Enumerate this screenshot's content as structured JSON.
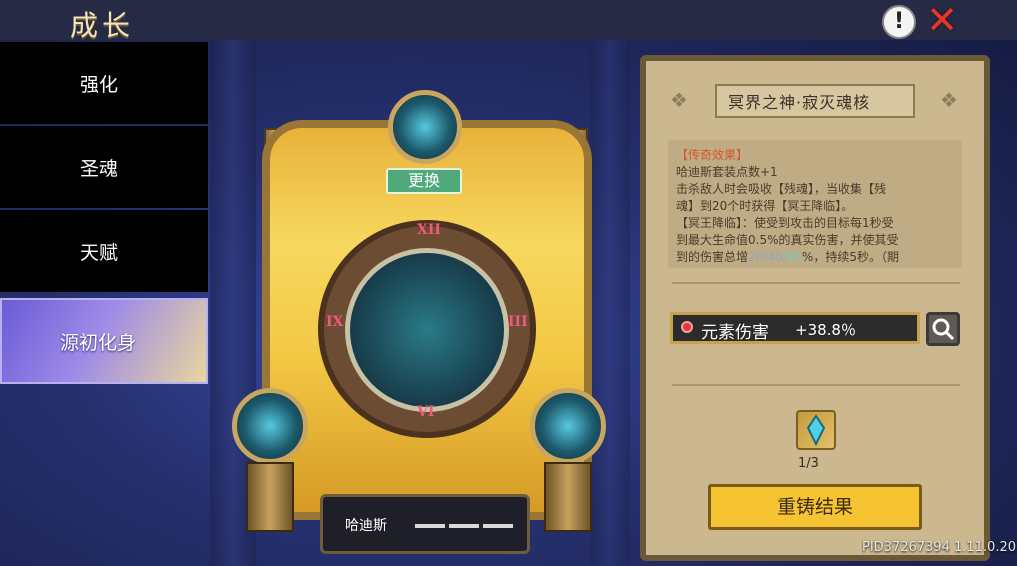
{
  "header": {
    "title": "成长"
  },
  "tabs": [
    {
      "label": "强化",
      "active": false
    },
    {
      "label": "圣魂",
      "active": false
    },
    {
      "label": "天赋",
      "active": false
    },
    {
      "label": "源初化身",
      "active": true
    }
  ],
  "center": {
    "replace_label": "更换",
    "numerals": {
      "top": "XII",
      "left": "IX",
      "right": "III",
      "bottom": "VI"
    },
    "character_name": "哈迪斯"
  },
  "panel": {
    "title": "冥界之神·寂灭魂核",
    "description": {
      "heading": "【传奇效果】",
      "line1": "哈迪斯套装点数+1",
      "line2": "击杀敌人时会吸收【残魂】，当收集【残",
      "line3": "魂】到20个时获得【冥王降临】。",
      "line4": "【冥王降临】：使受到攻击的目标每1秒受",
      "line5": "到最大生命值0.5%的真实伤害，并使其受",
      "line6_pre": "到的伤害总增",
      "line6_a": "20/40/",
      "line6_b": "60",
      "line6_post": "%，持续5秒。（期"
    },
    "stat": {
      "label": "元素伤害",
      "value": "+38.8％"
    },
    "gem_count": "1/3",
    "reforge_label": "重铸结果"
  },
  "footer": {
    "pid": "PID37267394 1.11.0.20"
  },
  "colors": {
    "accent_gold": "#f6c432",
    "active_tab": "#9d8ae8",
    "close_red": "#e03a2e"
  }
}
